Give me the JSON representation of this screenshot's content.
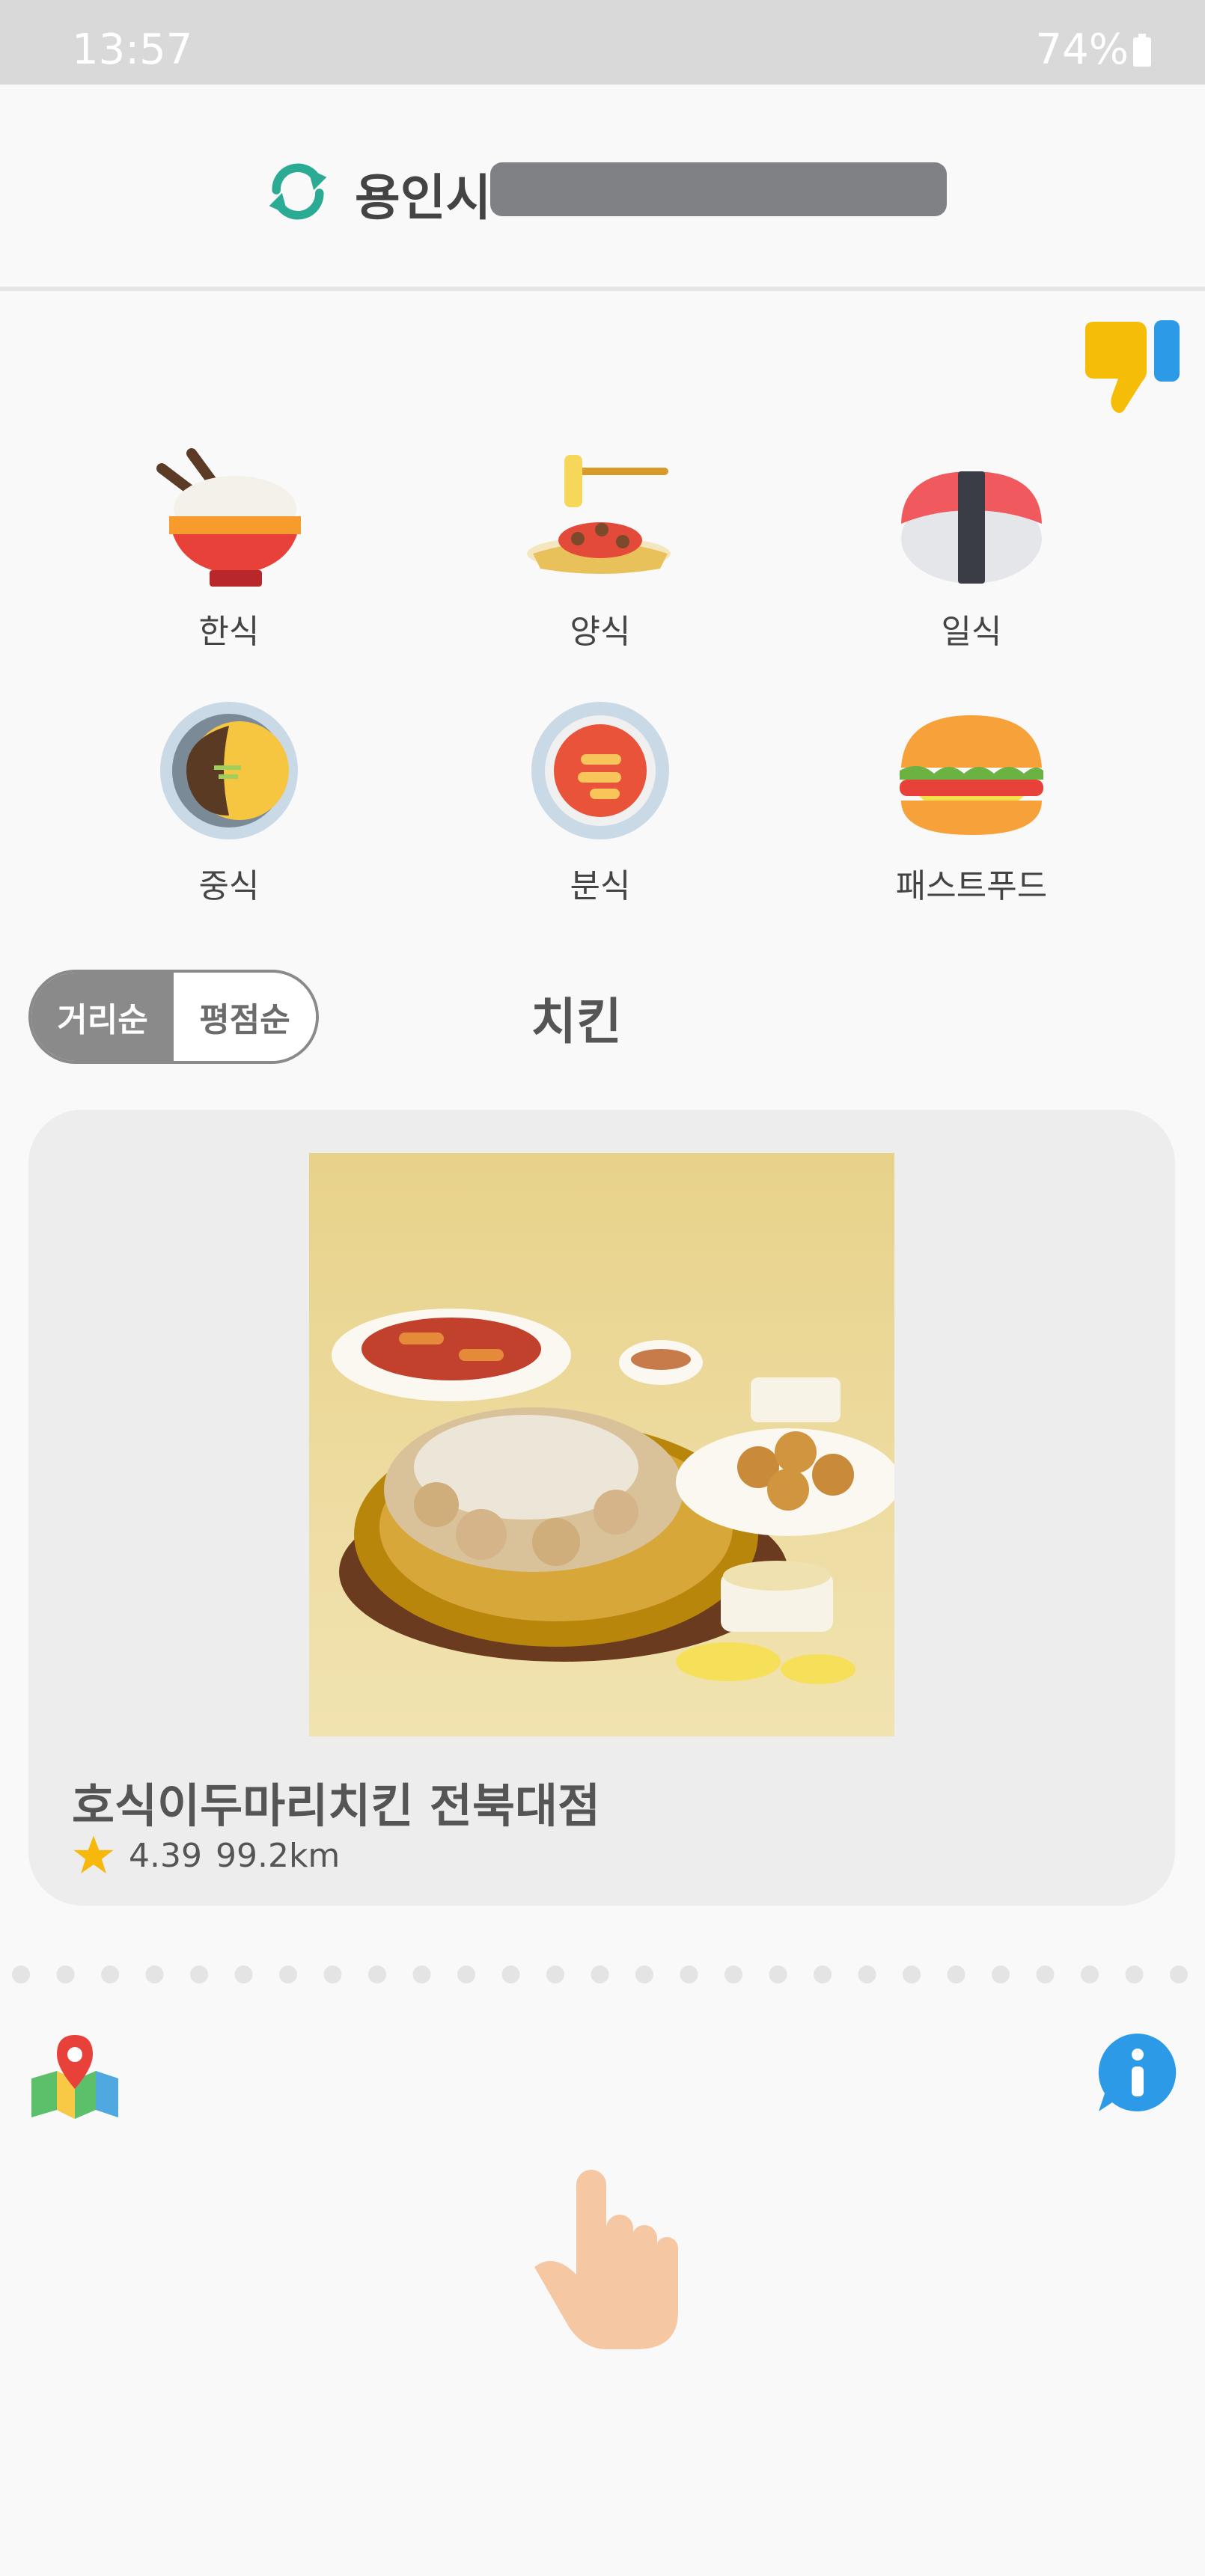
{
  "status_bar": {
    "time": "13:57",
    "battery": "74%"
  },
  "header": {
    "city": "용인시"
  },
  "categories": [
    {
      "label": "한식",
      "icon": "rice-bowl-icon"
    },
    {
      "label": "양식",
      "icon": "pasta-icon"
    },
    {
      "label": "일식",
      "icon": "sushi-icon"
    },
    {
      "label": "중식",
      "icon": "jajangmyeon-icon"
    },
    {
      "label": "분식",
      "icon": "tteokbokki-icon"
    },
    {
      "label": "패스트푸드",
      "icon": "burger-icon"
    }
  ],
  "sort": {
    "distance": "거리순",
    "rating": "평점순",
    "selected": "거리순"
  },
  "category_title": "치킨",
  "restaurant": {
    "name": "호식이두마리치킨 전북대점",
    "rating": "4.39",
    "distance": "99.2km"
  },
  "colors": {
    "accent_teal": "#2bab93",
    "dislike_yellow": "#f5bc08",
    "info_blue": "#2d9ae8",
    "toggle_gray": "#8a8a8a",
    "star_yellow": "#f7b80c"
  }
}
